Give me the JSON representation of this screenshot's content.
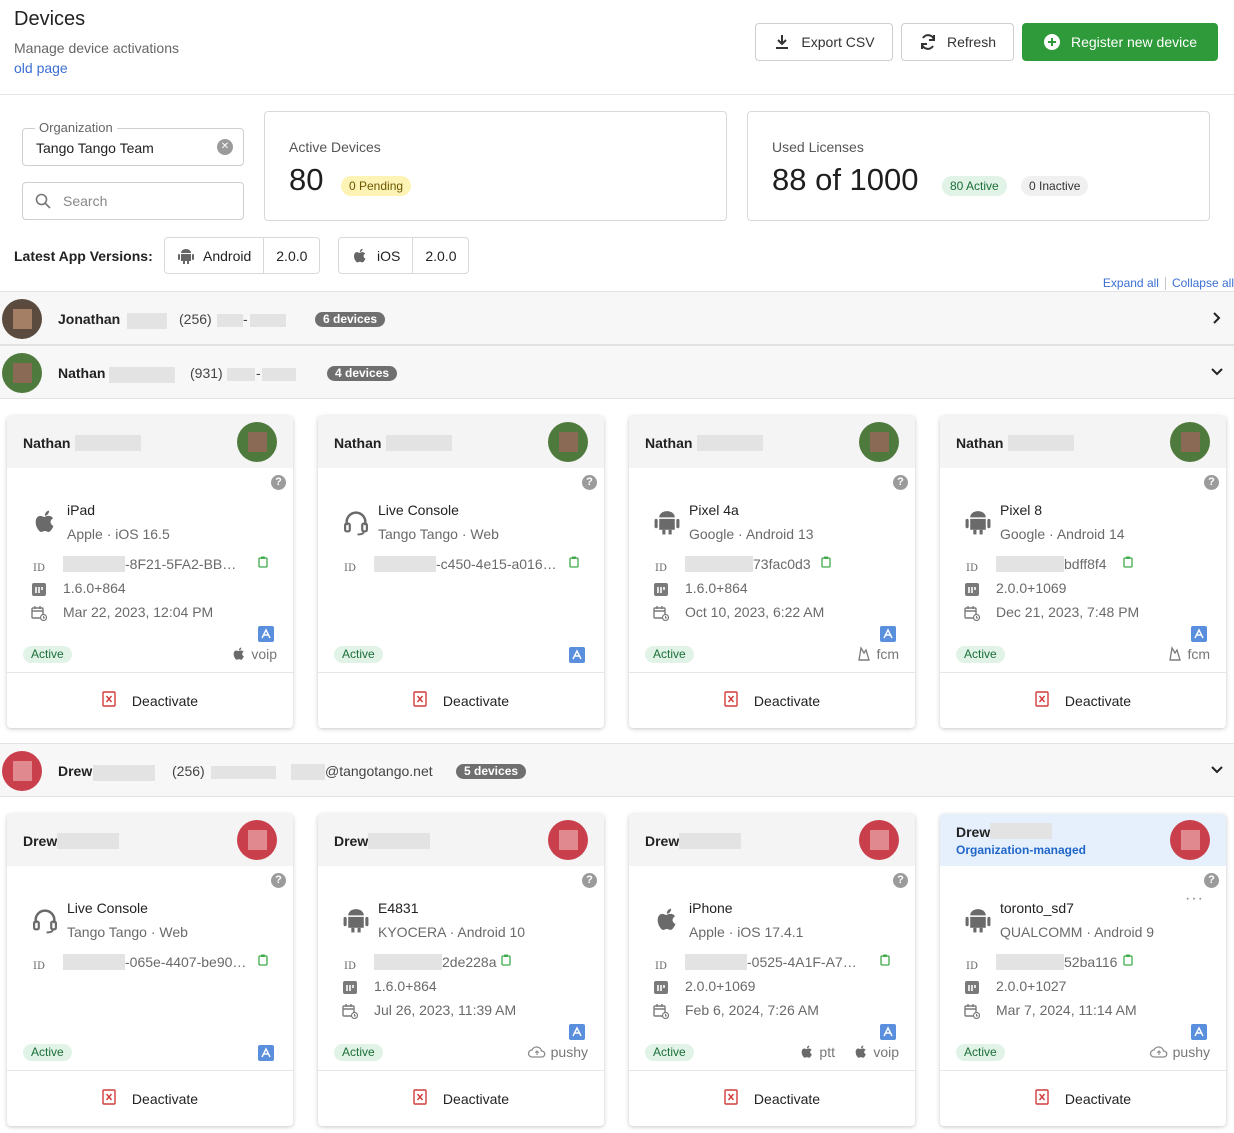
{
  "header": {
    "title": "Devices",
    "subtitle": "Manage device activations",
    "old_link": "old page",
    "export_label": "Export CSV",
    "refresh_label": "Refresh",
    "register_label": "Register new device"
  },
  "filters": {
    "org_legend": "Organization",
    "org_value": "Tango Tango Team",
    "search_placeholder": "Search"
  },
  "stats": {
    "active_label": "Active Devices",
    "active_value": "80",
    "pending_badge": "0 Pending",
    "licenses_label": "Used Licenses",
    "licenses_value": "88 of 1000",
    "active_badge": "80 Active",
    "inactive_badge": "0 Inactive"
  },
  "versions": {
    "label": "Latest App Versions:",
    "android_label": "Android",
    "android_version": "2.0.0",
    "ios_label": "iOS",
    "ios_version": "2.0.0"
  },
  "controls": {
    "expand_all": "Expand all",
    "collapse_all": "Collapse all"
  },
  "users": [
    {
      "name": "Jonathan",
      "phone_prefix": "(256)",
      "dash": "-",
      "count": "6 devices",
      "expanded": false
    },
    {
      "name": "Nathan",
      "phone_prefix": "(931)",
      "dash": "-",
      "count": "4 devices",
      "expanded": true
    },
    {
      "name": "Drew",
      "phone_prefix": "(256)",
      "email_suffix": "@tangotango.net",
      "count": "5 devices",
      "expanded": true
    }
  ],
  "cards": [
    {
      "user": "Nathan",
      "icon": "apple-icon",
      "device": "iPad",
      "sub": "Apple · iOS 16.5",
      "id": "-8F21-5FA2-BB…",
      "version": "1.6.0+864",
      "date": "Mar 22, 2023, 12:04 PM",
      "status": "Active",
      "push": [
        "voip"
      ]
    },
    {
      "user": "Nathan",
      "icon": "headset-icon",
      "device": "Live Console",
      "sub": "Tango Tango · Web",
      "id": "-c450-4e15-a016…",
      "status": "Active",
      "push": []
    },
    {
      "user": "Nathan",
      "icon": "android-icon",
      "device": "Pixel 4a",
      "sub": "Google · Android 13",
      "id": "73fac0d3",
      "version": "1.6.0+864",
      "date": "Oct 10, 2023, 6:22 AM",
      "status": "Active",
      "push": [
        "fcm"
      ]
    },
    {
      "user": "Nathan",
      "icon": "android-icon",
      "device": "Pixel 8",
      "sub": "Google · Android 14",
      "id": "bdff8f4",
      "version": "2.0.0+1069",
      "date": "Dec 21, 2023, 7:48 PM",
      "status": "Active",
      "push": [
        "fcm"
      ]
    },
    {
      "user": "Drew",
      "icon": "headset-icon",
      "device": "Live Console",
      "sub": "Tango Tango · Web",
      "id": "-065e-4407-be90…",
      "status": "Active",
      "push": []
    },
    {
      "user": "Drew",
      "icon": "android-icon",
      "device": "E4831",
      "sub": "KYOCERA · Android 10",
      "id": "2de228a",
      "version": "1.6.0+864",
      "date": "Jul 26, 2023, 11:39 AM",
      "status": "Active",
      "push": [
        "pushy"
      ]
    },
    {
      "user": "Drew",
      "icon": "apple-icon",
      "device": "iPhone",
      "sub": "Apple · iOS 17.4.1",
      "id": "-0525-4A1F-A7…",
      "version": "2.0.0+1069",
      "date": "Feb 6, 2024, 7:26 AM",
      "status": "Active",
      "push": [
        "ptt",
        "voip"
      ]
    },
    {
      "user": "Drew",
      "managed": "Organization-managed",
      "icon": "android-icon",
      "device": "toronto_sd7",
      "sub": "QUALCOMM · Android 9",
      "id": "52ba116",
      "version": "2.0.0+1027",
      "date": "Mar 7, 2024, 11:14 AM",
      "status": "Active",
      "push": [
        "pushy"
      ]
    }
  ],
  "labels": {
    "id": "ID",
    "deactivate": "Deactivate",
    "help": "?"
  },
  "colors": {
    "primary": "#2e9a3a",
    "link": "#3b6fd4",
    "active_bg": "#e0f3e6",
    "managed_bg": "#e6f0fc"
  }
}
